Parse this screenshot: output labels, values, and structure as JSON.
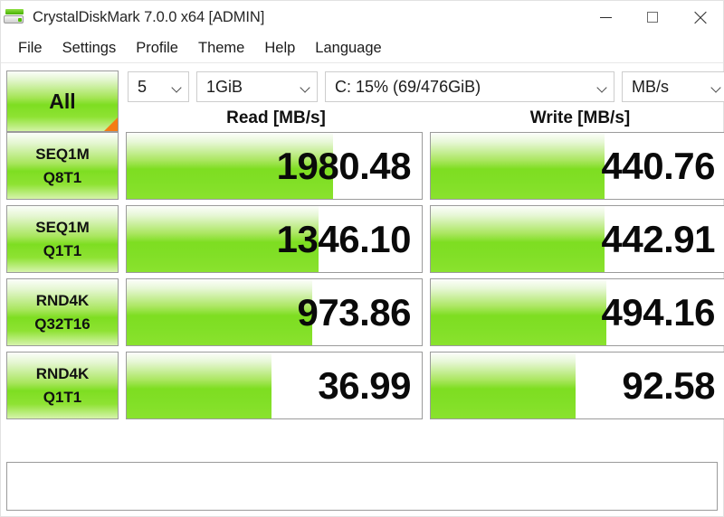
{
  "window": {
    "title": "CrystalDiskMark 7.0.0 x64 [ADMIN]",
    "icon": "disk-drive-icon",
    "controls": {
      "minimize": "minimize-icon",
      "maximize": "maximize-icon",
      "close": "close-icon"
    }
  },
  "menu": {
    "items": [
      {
        "label": "File"
      },
      {
        "label": "Settings"
      },
      {
        "label": "Profile"
      },
      {
        "label": "Theme"
      },
      {
        "label": "Help"
      },
      {
        "label": "Language"
      }
    ]
  },
  "toolbar": {
    "all_button": "All",
    "count": "5",
    "size": "1GiB",
    "drive": "C: 15% (69/476GiB)",
    "unit": "MB/s"
  },
  "headers": {
    "read": "Read [MB/s]",
    "write": "Write [MB/s]"
  },
  "comment": "",
  "colors": {
    "bar_green": "#7ede21",
    "bar_green_light": "#a9e65e",
    "accent_orange": "#f57c14",
    "border_gray": "#9b9b9b"
  },
  "chart_data": {
    "type": "bar",
    "title": "CrystalDiskMark 7.0.0 x64 [ADMIN]",
    "xlabel": "",
    "ylabel": "",
    "unit": "MB/s",
    "test_count": "5",
    "test_size": "1GiB",
    "target_drive": "C: 15% (69/476GiB)",
    "categories": [
      "SEQ1M Q8T1",
      "SEQ1M Q1T1",
      "RND4K Q32T16",
      "RND4K Q1T1"
    ],
    "series": [
      {
        "name": "Read [MB/s]",
        "values": [
          1980.48,
          1346.1,
          973.86,
          36.99
        ]
      },
      {
        "name": "Write [MB/s]",
        "values": [
          440.76,
          442.91,
          494.16,
          92.58
        ]
      }
    ]
  },
  "rows": [
    {
      "line1": "SEQ1M",
      "line2": "Q8T1",
      "read": {
        "value": "1980.48",
        "fill_pct": 70
      },
      "write": {
        "value": "440.76",
        "fill_pct": 59
      }
    },
    {
      "line1": "SEQ1M",
      "line2": "Q1T1",
      "read": {
        "value": "1346.10",
        "fill_pct": 65
      },
      "write": {
        "value": "442.91",
        "fill_pct": 59
      }
    },
    {
      "line1": "RND4K",
      "line2": "Q32T16",
      "read": {
        "value": "973.86",
        "fill_pct": 63
      },
      "write": {
        "value": "494.16",
        "fill_pct": 59.5
      }
    },
    {
      "line1": "RND4K",
      "line2": "Q1T1",
      "read": {
        "value": "36.99",
        "fill_pct": 49
      },
      "write": {
        "value": "92.58",
        "fill_pct": 49
      }
    }
  ]
}
